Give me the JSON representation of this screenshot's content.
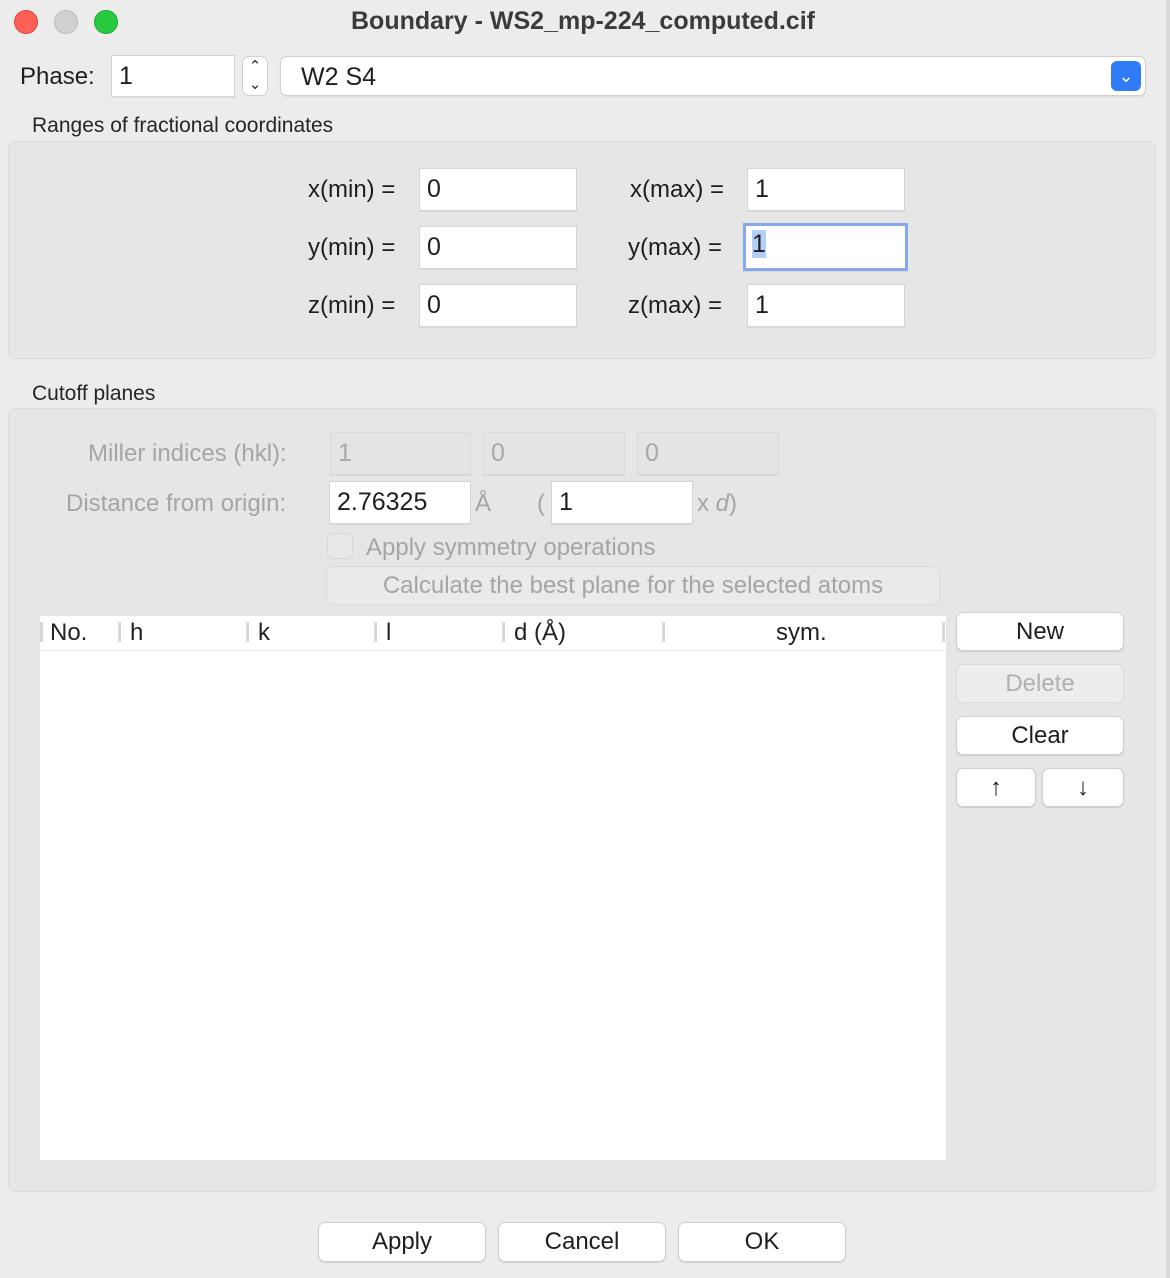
{
  "window": {
    "title": "Boundary - WS2_mp-224_computed.cif"
  },
  "phase": {
    "label": "Phase:",
    "value": "1",
    "name": "W2 S4"
  },
  "ranges": {
    "title": "Ranges of fractional coordinates",
    "xmin_label": "x(min) =",
    "xmin": "0",
    "ymin_label": "y(min) =",
    "ymin": "0",
    "zmin_label": "z(min) =",
    "zmin": "0",
    "xmax_label": "x(max) =",
    "xmax": "1",
    "ymax_label": "y(max) =",
    "ymax": "1",
    "zmax_label": "z(max) =",
    "zmax": "1"
  },
  "cutoff": {
    "title": "Cutoff planes",
    "miller_label": "Miller indices (hkl):",
    "h": "1",
    "k": "0",
    "l": "0",
    "distance_label": "Distance from origin:",
    "distance": "2.76325",
    "angstrom": "Å",
    "open_paren": "(",
    "multiplier": "1",
    "times_label": "x",
    "d_label": "d",
    "close_paren": ")",
    "symmetry_label": "Apply symmetry operations",
    "calc_button": "Calculate the best plane for the selected atoms"
  },
  "table": {
    "columns": [
      "No.",
      "h",
      "k",
      "l",
      "d (Å)",
      "sym."
    ],
    "rows": []
  },
  "side_buttons": {
    "new": "New",
    "delete": "Delete",
    "clear": "Clear",
    "up": "↑",
    "down": "↓"
  },
  "footer": {
    "apply": "Apply",
    "cancel": "Cancel",
    "ok": "OK"
  }
}
